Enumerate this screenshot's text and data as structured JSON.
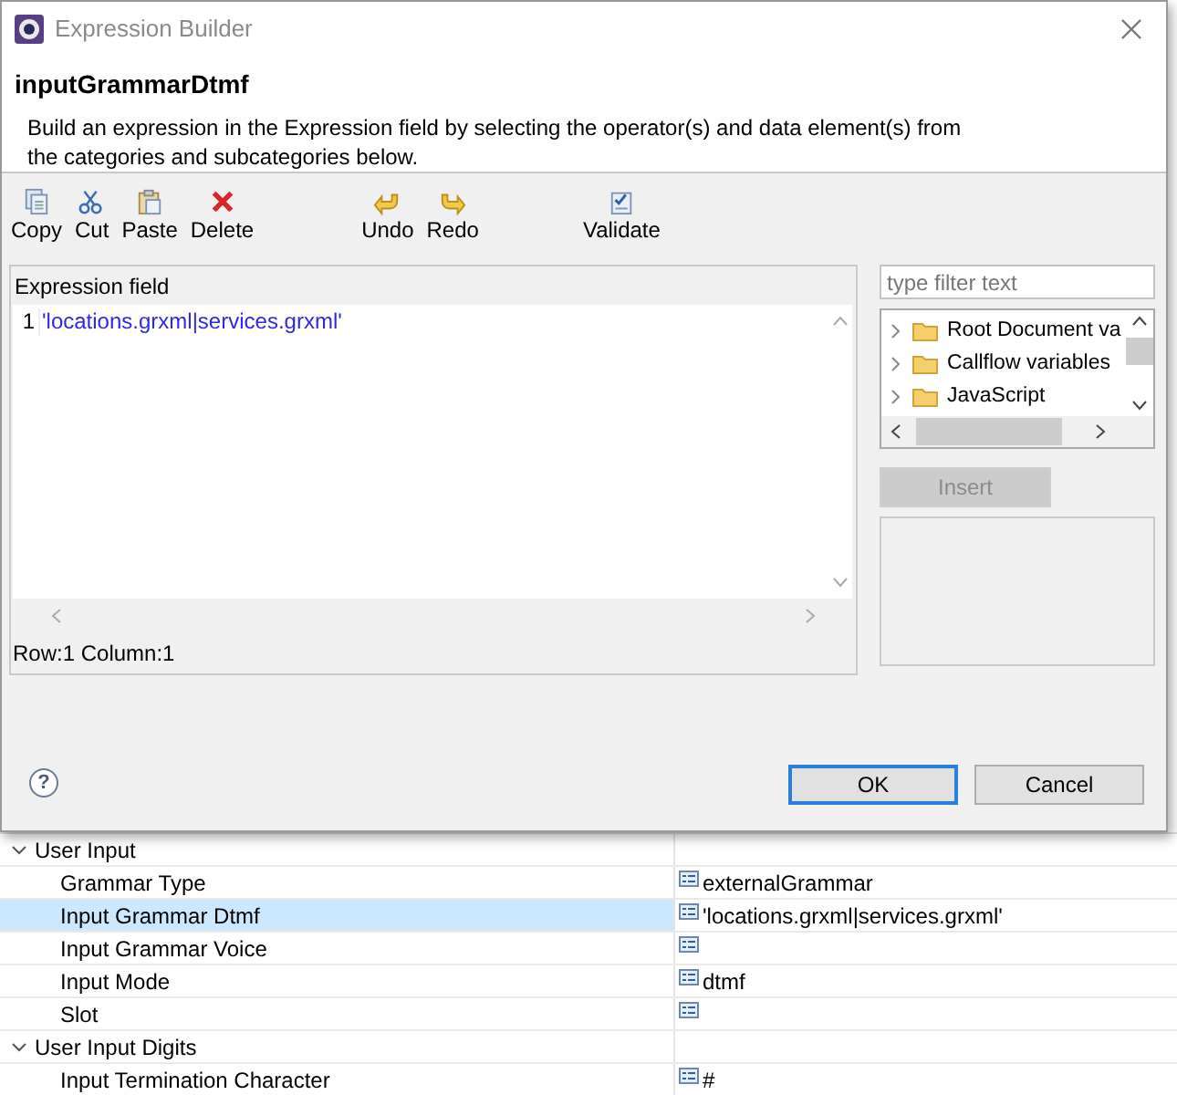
{
  "window": {
    "title": "Expression Builder"
  },
  "header": {
    "title": "inputGrammarDtmf",
    "description": "Build an expression in the Expression field by selecting the operator(s) and data element(s) from the categories and subcategories below."
  },
  "toolbar": [
    {
      "kind": "copy",
      "label": "Copy"
    },
    {
      "kind": "cut",
      "label": "Cut"
    },
    {
      "kind": "paste",
      "label": "Paste"
    },
    {
      "kind": "delete",
      "label": "Delete"
    },
    {
      "kind": "undo",
      "label": "Undo"
    },
    {
      "kind": "redo",
      "label": "Redo"
    },
    {
      "kind": "validate",
      "label": "Validate"
    }
  ],
  "expression_field": {
    "label": "Expression field",
    "lines": [
      {
        "number": "1",
        "text": "'locations.grxml|services.grxml'"
      }
    ],
    "status": "Row:1 Column:1"
  },
  "filter": {
    "placeholder": "type filter text"
  },
  "tree": [
    {
      "label": "Root Document va",
      "expanded": false
    },
    {
      "label": "Callflow variables",
      "expanded": false
    },
    {
      "label": "JavaScript",
      "expanded": false
    }
  ],
  "insert_button": {
    "label": "Insert",
    "disabled": true
  },
  "help": {
    "label": "?"
  },
  "buttons": [
    {
      "label": "OK",
      "default": true
    },
    {
      "label": "Cancel",
      "default": false
    }
  ],
  "properties": [
    {
      "label": "User Input",
      "expanded": true,
      "children": [
        {
          "name": "Grammar Type",
          "value": "externalGrammar",
          "selected": false
        },
        {
          "name": "Input Grammar Dtmf",
          "value": "'locations.grxml|services.grxml'",
          "selected": true
        },
        {
          "name": "Input Grammar Voice",
          "selected": false
        },
        {
          "name": "Input Mode",
          "value": "dtmf",
          "selected": false
        },
        {
          "name": "Slot",
          "selected": false
        }
      ]
    },
    {
      "label": "User Input Digits",
      "expanded": true,
      "children": [
        {
          "name": "Input Termination Character",
          "value": "#",
          "selected": false
        }
      ]
    }
  ]
}
